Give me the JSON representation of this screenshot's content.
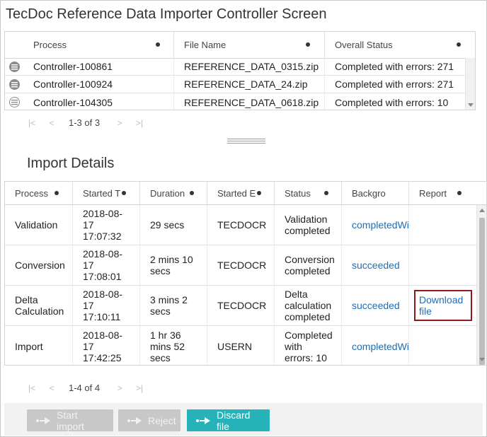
{
  "app": {
    "title": "TecDoc Reference Data Importer Controller Screen"
  },
  "controllers": {
    "columns": [
      "Process",
      "File Name",
      "Overall Status"
    ],
    "rows": [
      {
        "process": "Controller-100861",
        "file": "REFERENCE_DATA_0315.zip",
        "status": "Completed with errors: 271",
        "icon": "list-icon"
      },
      {
        "process": "Controller-100924",
        "file": "REFERENCE_DATA_24.zip",
        "status": "Completed with errors: 271",
        "icon": "list-icon"
      },
      {
        "process": "Controller-104305",
        "file": "REFERENCE_DATA_0618.zip",
        "status": "Completed with errors: 10",
        "icon": "list-outline-icon"
      }
    ],
    "pager": {
      "info": "1-3 of 3"
    }
  },
  "details": {
    "title": "Import Details",
    "columns": [
      "Process",
      "Started T",
      "Duration",
      "Started E",
      "Status",
      "Backgro",
      "Report"
    ],
    "rows": [
      {
        "process": "Validation",
        "started": "2018-08-17 17:07:32",
        "duration": "29 secs",
        "by": "TECDOCR",
        "status": "Validation completed",
        "background": "completedWithWarnings",
        "report": ""
      },
      {
        "process": "Conversion",
        "started": "2018-08-17 17:08:01",
        "duration": "2 mins 10 secs",
        "by": "TECDOCR",
        "status": "Conversion completed",
        "background": "succeeded",
        "report": ""
      },
      {
        "process": "Delta Calculation",
        "started": "2018-08-17 17:10:11",
        "duration": "3 mins 2 secs",
        "by": "TECDOCR",
        "status": "Delta calculation completed",
        "background": "succeeded",
        "report": "Download file"
      },
      {
        "process": "Import",
        "started": "2018-08-17 17:42:25",
        "duration": "1 hr 36 mins 52 secs",
        "by": "USERN",
        "status": "Completed with errors: 10",
        "background": "completedWithWarnings",
        "report": ""
      }
    ],
    "pager": {
      "info": "1-4 of 4"
    }
  },
  "actions": {
    "start_import": "Start import",
    "reject": "Reject",
    "discard_file": "Discard file"
  },
  "colors": {
    "accent": "#25b2b8",
    "link": "#1f6db5",
    "highlight_border": "#8b1a1a",
    "disabled": "#c8c8c8"
  }
}
